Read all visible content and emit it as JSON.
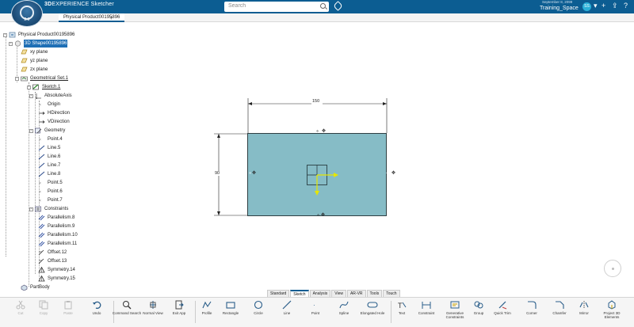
{
  "app": {
    "brand_bold": "3D",
    "brand_rest": "EXPERIENCE Sketcher",
    "version": "2.0",
    "search_placeholder": "Search",
    "date": "September 8, 2099",
    "space": "Training_Space",
    "avatar": "SS"
  },
  "tab": {
    "label": "Physical Product00195896",
    "plus": "+"
  },
  "tree": {
    "root": "Physical Product00195896",
    "shape": "3D Shape00195896",
    "planes": [
      "xy plane",
      "yz plane",
      "zx plane"
    ],
    "geo_set": "Geometrical Set.1",
    "sketch": "Sketch.1",
    "axis": "AbsoluteAxis",
    "axis_items": [
      "Origin",
      "HDirection",
      "VDirection"
    ],
    "geometry": "Geometry",
    "geometry_items": [
      "Point.4",
      "Line.5",
      "Line.6",
      "Line.7",
      "Line.8",
      "Point.5",
      "Point.6",
      "Point.7"
    ],
    "constraints": "Constraints",
    "constraint_items": [
      "Parallelism.8",
      "Parallelism.9",
      "Parallelism.10",
      "Parallelism.11",
      "Offset.12",
      "Offset.13",
      "Symmetry.14",
      "Symmetry.15"
    ],
    "part_body": "PartBody"
  },
  "sketch": {
    "dim_width": "150",
    "dim_height": "90",
    "fill": "#86bcc6"
  },
  "bottom_tabs": [
    "Standard",
    "Sketch",
    "Analysis",
    "View",
    "AR-VR",
    "Tools",
    "Touch"
  ],
  "active_tab": "Sketch",
  "tools": [
    {
      "label": "Cut",
      "icon": "cut-icon",
      "disabled": true
    },
    {
      "label": "Copy",
      "icon": "copy-icon",
      "disabled": true
    },
    {
      "label": "Paste",
      "icon": "paste-icon",
      "disabled": true
    },
    {
      "label": "Undo",
      "icon": "undo-icon",
      "disabled": false
    },
    {
      "label": "Command Search",
      "icon": "command-search-icon",
      "disabled": false
    },
    {
      "label": "Normal View",
      "icon": "normal-view-icon",
      "disabled": false
    },
    {
      "label": "Exit App",
      "icon": "exit-app-icon",
      "disabled": false
    },
    {
      "label": "Profile",
      "icon": "profile-icon",
      "disabled": false
    },
    {
      "label": "Rectangle",
      "icon": "rectangle-icon",
      "disabled": false
    },
    {
      "label": "Circle",
      "icon": "circle-icon",
      "disabled": false
    },
    {
      "label": "Line",
      "icon": "line-icon",
      "disabled": false
    },
    {
      "label": "Point",
      "icon": "point-icon",
      "disabled": false
    },
    {
      "label": "Spline",
      "icon": "spline-icon",
      "disabled": false
    },
    {
      "label": "Elongated Hole",
      "icon": "elongated-hole-icon",
      "disabled": false
    },
    {
      "label": "Text",
      "icon": "text-icon",
      "disabled": false
    },
    {
      "label": "Constraint",
      "icon": "constraint-icon",
      "disabled": false
    },
    {
      "label": "Generative Constraints",
      "icon": "generative-constraints-icon",
      "disabled": false
    },
    {
      "label": "Group",
      "icon": "group-icon",
      "disabled": false
    },
    {
      "label": "Quick Trim",
      "icon": "quick-trim-icon",
      "disabled": false
    },
    {
      "label": "Corner",
      "icon": "corner-icon",
      "disabled": false
    },
    {
      "label": "Chamfer",
      "icon": "chamfer-icon",
      "disabled": false
    },
    {
      "label": "Mirror",
      "icon": "mirror-icon",
      "disabled": false
    },
    {
      "label": "Project 3D Elements",
      "icon": "project-3d-elements-icon",
      "disabled": false
    }
  ]
}
